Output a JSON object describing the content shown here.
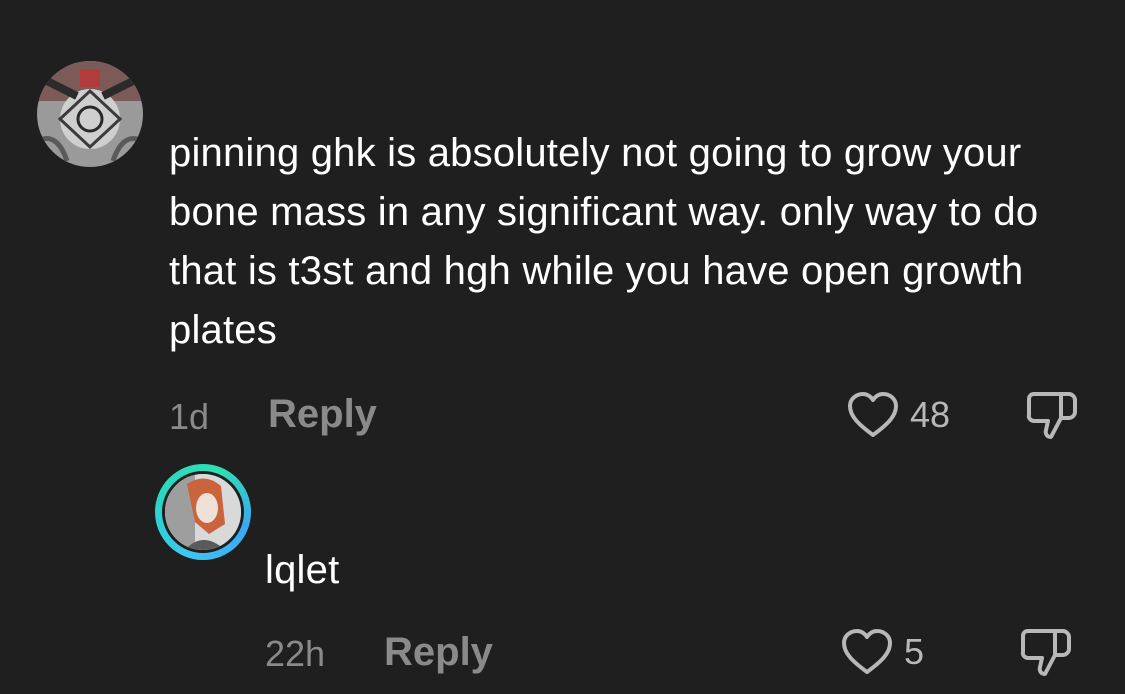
{
  "comments": [
    {
      "text": "pinning ghk is absolutely not going to grow your bone mass in any significant way. only way to do that is t3st and hgh while you have open growth plates",
      "time": "1d",
      "reply_label": "Reply",
      "likes": "48",
      "avatar": "user-avatar"
    },
    {
      "text": "lqlet",
      "time": "22h",
      "reply_label": "Reply",
      "likes": "5",
      "avatar": "user-avatar-with-story-ring"
    }
  ],
  "icons": {
    "like": "heart-outline-icon",
    "dislike": "thumbs-down-outline-icon"
  },
  "colors": {
    "background": "#1f1f1f",
    "text": "#ffffff",
    "muted": "#8a8a8a",
    "story_ring": "#27d7c5"
  }
}
